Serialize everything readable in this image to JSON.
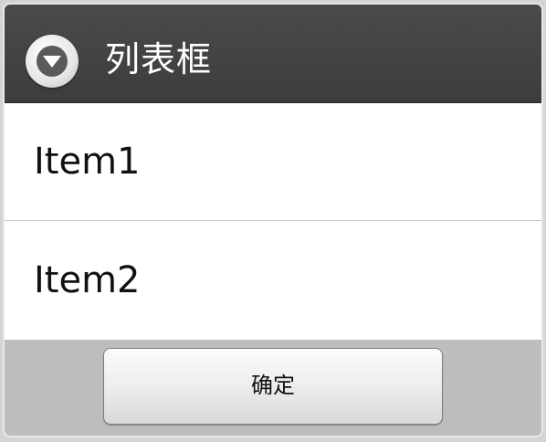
{
  "dialog": {
    "title": "列表框",
    "header_icon": "dropdown-circle-icon"
  },
  "list": {
    "items": [
      {
        "label": "Item1"
      },
      {
        "label": "Item2"
      }
    ]
  },
  "footer": {
    "ok_label": "确定"
  }
}
